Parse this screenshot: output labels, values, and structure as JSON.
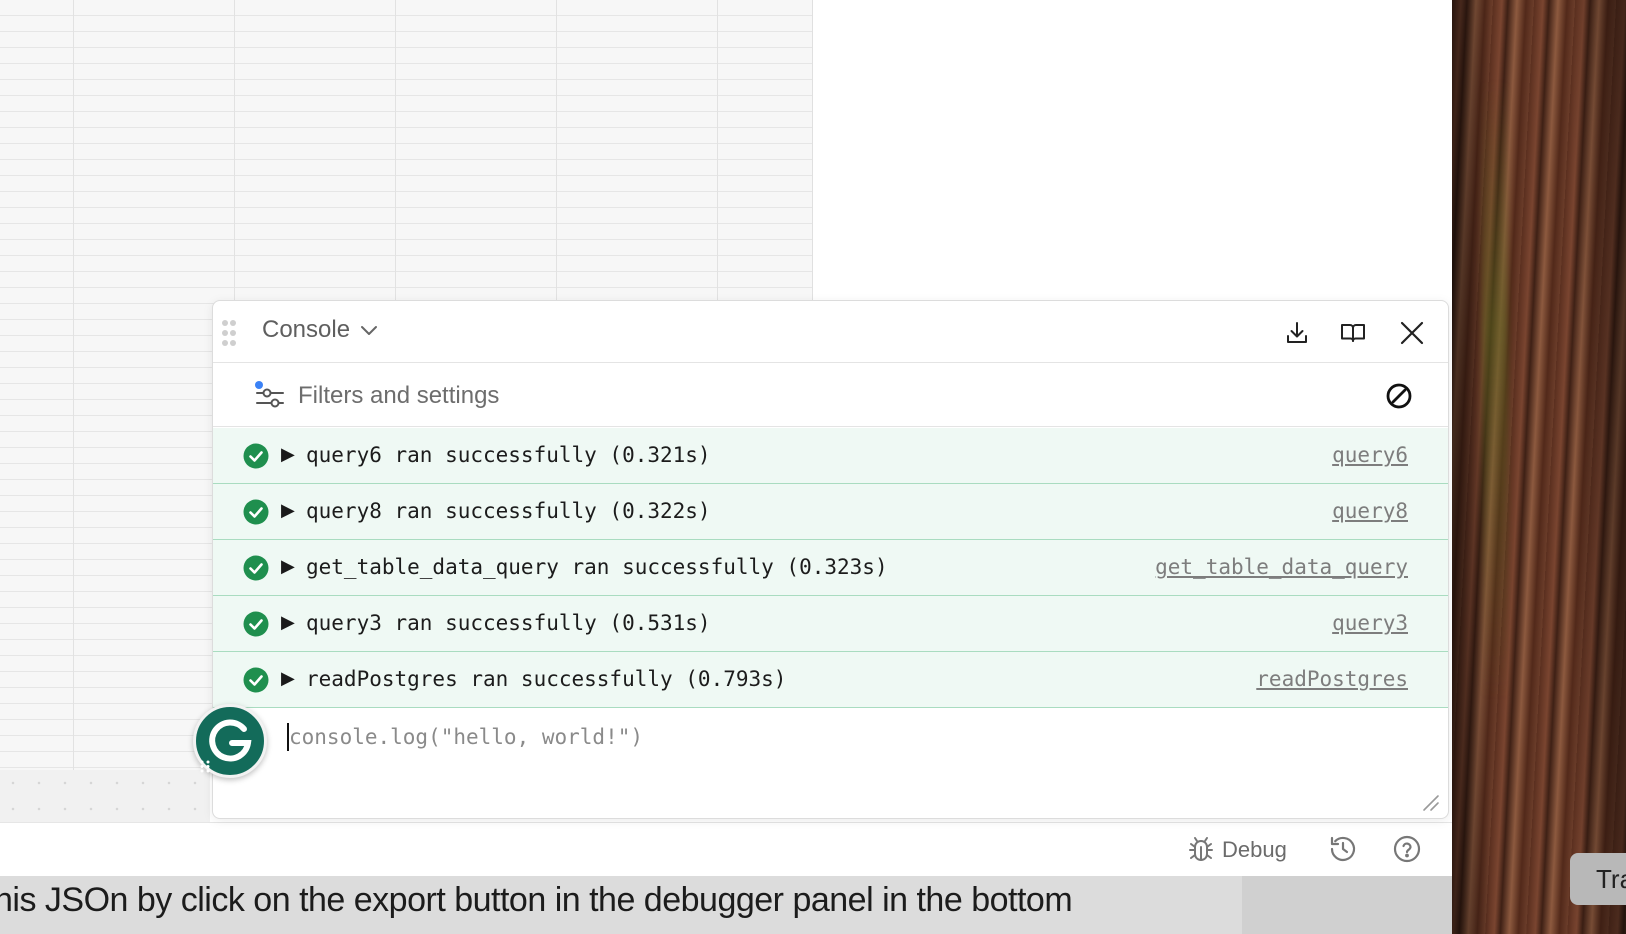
{
  "console": {
    "title": "Console",
    "filters_label": "Filters and settings",
    "input_placeholder": "console.log(\"hello, world!\")",
    "logs": [
      {
        "text": "query6 ran successfully (0.321s)",
        "link": "query6"
      },
      {
        "text": "query8 ran successfully (0.322s)",
        "link": "query8"
      },
      {
        "text": "get_table_data_query ran successfully (0.323s)",
        "link": "get_table_data_query"
      },
      {
        "text": "query3 ran successfully (0.531s)",
        "link": "query3"
      },
      {
        "text": "readPostgres ran successfully (0.793s)",
        "link": "readPostgres"
      }
    ]
  },
  "bottom_bar": {
    "debug_label": "Debug"
  },
  "caption": "his JSOn by click on the export button in the debugger panel in the bottom",
  "tooltip_text": "Tra",
  "colors": {
    "success_green": "#1f8f4e",
    "row_background": "#eff9f4",
    "row_border": "#a9dcc0",
    "grammarly_teal": "#136b5a",
    "filter_dot_blue": "#3b82f6"
  },
  "icons": {
    "drag": "drag-handle-icon",
    "chevron": "chevron-down-icon",
    "export": "download-icon",
    "docs": "book-icon",
    "close": "close-icon",
    "filter": "sliders-icon",
    "clear": "clear-icon",
    "success": "check-circle-icon",
    "expand": "expand-arrow-icon",
    "debug": "bug-icon",
    "history": "history-icon",
    "help": "help-icon",
    "grammarly": "grammarly-icon"
  }
}
